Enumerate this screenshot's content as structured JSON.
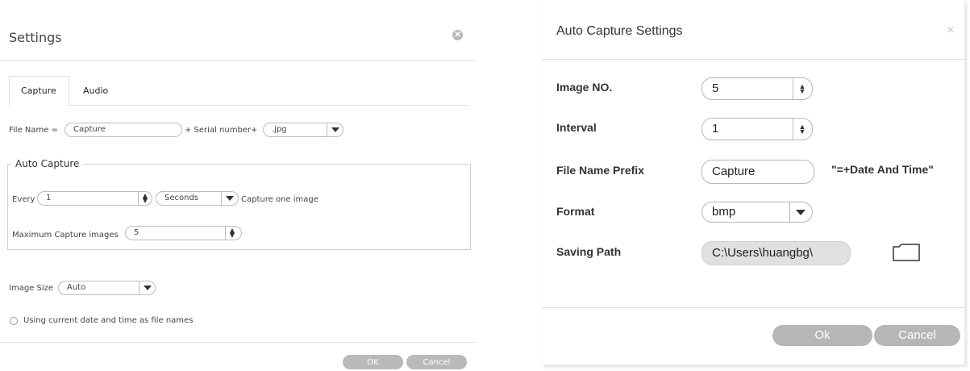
{
  "left_dialog": {
    "title": "Settings",
    "tabs": [
      {
        "label": "Capture",
        "active": true
      },
      {
        "label": "Audio",
        "active": false
      }
    ],
    "file_name": {
      "label": "File Name =",
      "value": "Capture",
      "serial_label": "+ Serial number+",
      "format_value": ".jpg"
    },
    "auto_capture": {
      "legend": "Auto Capture",
      "every_label": "Every",
      "every_value": "1",
      "unit_value": "Seconds",
      "capture_text": "Capture one image",
      "max_label": "Maximum Capture images",
      "max_value": "5"
    },
    "image_size": {
      "label": "Image Size",
      "value": "Auto"
    },
    "date_option": {
      "label": "Using current date and time as file names",
      "checked": false
    },
    "buttons": {
      "ok": "OK",
      "cancel": "Cancel"
    }
  },
  "right_dialog": {
    "title": "Auto Capture Settings",
    "close_glyph": "×",
    "fields": {
      "image_no": {
        "label": "Image NO.",
        "value": "5"
      },
      "interval": {
        "label": "Interval",
        "value": "1"
      },
      "prefix": {
        "label": "File Name Prefix",
        "value": "Capture",
        "suffix": "\"=+Date And Time\""
      },
      "format": {
        "label": "Format",
        "value": "bmp"
      },
      "saving_path": {
        "label": "Saving Path",
        "value": "C:\\Users\\huangbg\\"
      }
    },
    "buttons": {
      "ok": "Ok",
      "cancel": "Cancel"
    }
  },
  "colors": {
    "button_grey": "#b9b9b9",
    "border": "#bdbdbd"
  }
}
